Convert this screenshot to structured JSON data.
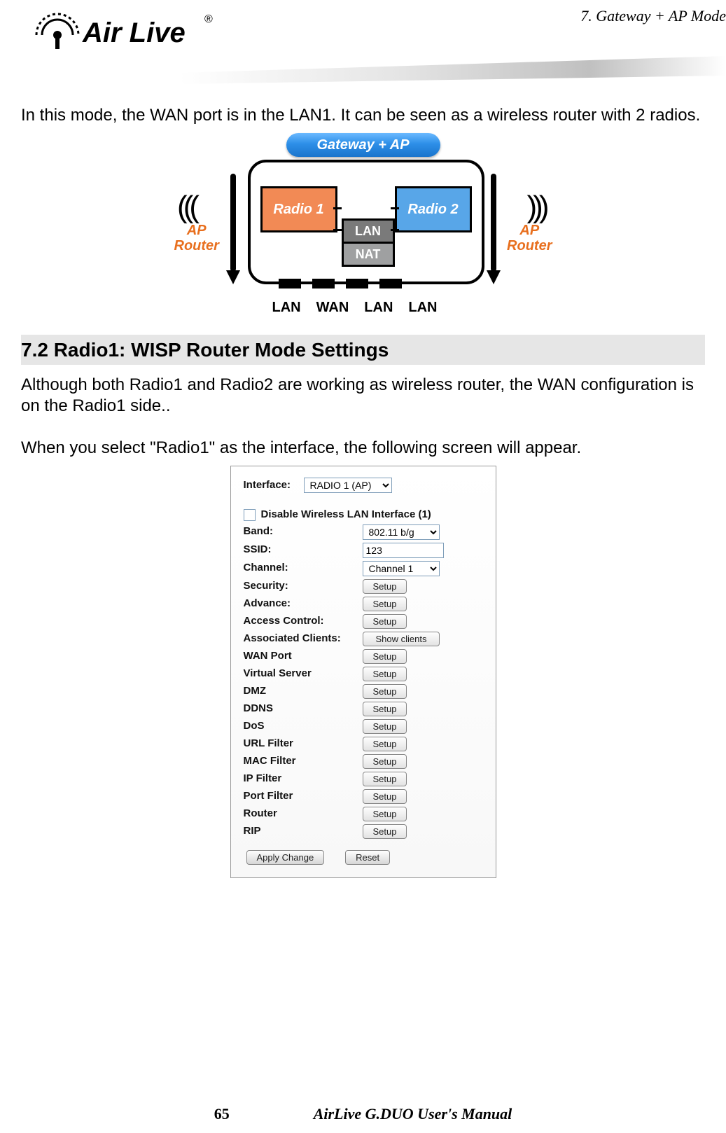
{
  "header": {
    "chapter": "7.  Gateway  +  AP    Mode",
    "logo_text": "Air Live",
    "logo_reg": "®"
  },
  "intro": "In this mode, the WAN port is in the LAN1.    It can be seen as a wireless router with 2 radios.",
  "diagram": {
    "pill": "Gateway + AP",
    "radio1": "Radio 1",
    "radio2": "Radio 2",
    "lan": "LAN",
    "nat": "NAT",
    "side_left_l1": "AP",
    "side_left_l2": "Router",
    "side_right_l1": "AP",
    "side_right_l2": "Router",
    "ports": [
      "LAN",
      "WAN",
      "LAN",
      "LAN"
    ]
  },
  "section": {
    "title": "7.2 Radio1:  WISP  Router  Mode  Settings",
    "para1": "Although both Radio1 and Radio2 are working as wireless router, the WAN configuration is on the Radio1 side..",
    "para2": "When you select \"Radio1\" as the interface, the following screen will appear."
  },
  "form": {
    "interface_label": "Interface:",
    "interface_value": "RADIO 1 (AP)",
    "disable_label": "Disable Wireless LAN Interface (1)",
    "band_label": "Band:",
    "band_value": "802.11 b/g",
    "ssid_label": "SSID:",
    "ssid_value": "123",
    "channel_label": "Channel:",
    "channel_value": "Channel 1",
    "security_label": "Security:",
    "advance_label": "Advance:",
    "access_label": "Access Control:",
    "assoc_label": "Associated Clients:",
    "assoc_button": "Show clients",
    "wan_label": "WAN Port",
    "vserver_label": "Virtual Server",
    "dmz_label": "DMZ",
    "ddns_label": "DDNS",
    "dos_label": "DoS",
    "url_label": "URL Filter",
    "mac_label": "MAC Filter",
    "ip_label": "IP Filter",
    "port_label": "Port Filter",
    "router_label": "Router",
    "rip_label": "RIP",
    "setup_button": "Setup",
    "apply_button": "Apply Change",
    "reset_button": "Reset"
  },
  "footer": {
    "page": "65",
    "manual": "AirLive  G.DUO  User's  Manual"
  }
}
